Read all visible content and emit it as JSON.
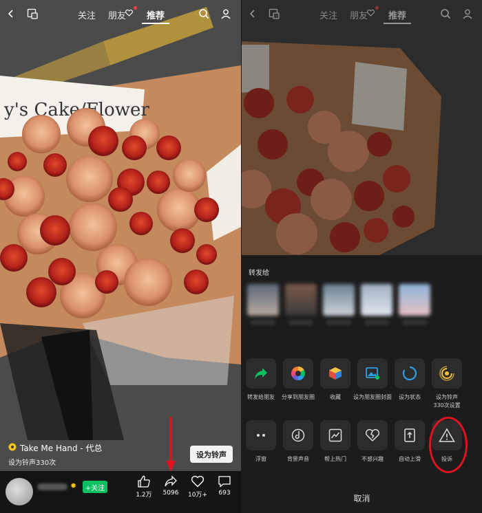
{
  "nav": {
    "tabs": [
      "关注",
      "朋友",
      "推荐"
    ],
    "active_tab": "推荐"
  },
  "music": {
    "title": "Take Me Hand - 代总",
    "subtitle": "设为铃声330次",
    "ringtone_button": "设为铃声"
  },
  "author": {
    "follow_button": "+关注"
  },
  "actions": {
    "like_count": "1.2万",
    "share_count": "5096",
    "favorite_count": "10万+",
    "comment_count": "693"
  },
  "share_sheet": {
    "title": "转发给",
    "row1": [
      {
        "label": "转发给朋友",
        "icon": "forward-icon"
      },
      {
        "label": "分享到朋友圈",
        "icon": "moments-icon"
      },
      {
        "label": "收藏",
        "icon": "favorite-box-icon"
      },
      {
        "label": "设为朋友圈封面",
        "icon": "cover-icon"
      },
      {
        "label": "设为状态",
        "icon": "status-icon"
      },
      {
        "label": "设为铃声",
        "sub": "330次设置",
        "icon": "ringtone-icon"
      }
    ],
    "row2": [
      {
        "label": "浮窗",
        "icon": "float-window-icon"
      },
      {
        "label": "背景声音",
        "icon": "background-sound-icon"
      },
      {
        "label": "帮上热门",
        "icon": "trending-icon"
      },
      {
        "label": "不感兴趣",
        "icon": "broken-heart-icon"
      },
      {
        "label": "自动上滑",
        "icon": "auto-scroll-icon"
      },
      {
        "label": "投诉",
        "icon": "warning-icon"
      }
    ],
    "cancel": "取消"
  },
  "colors": {
    "follow_green": "#07c160",
    "highlight_red": "#e0141e"
  }
}
